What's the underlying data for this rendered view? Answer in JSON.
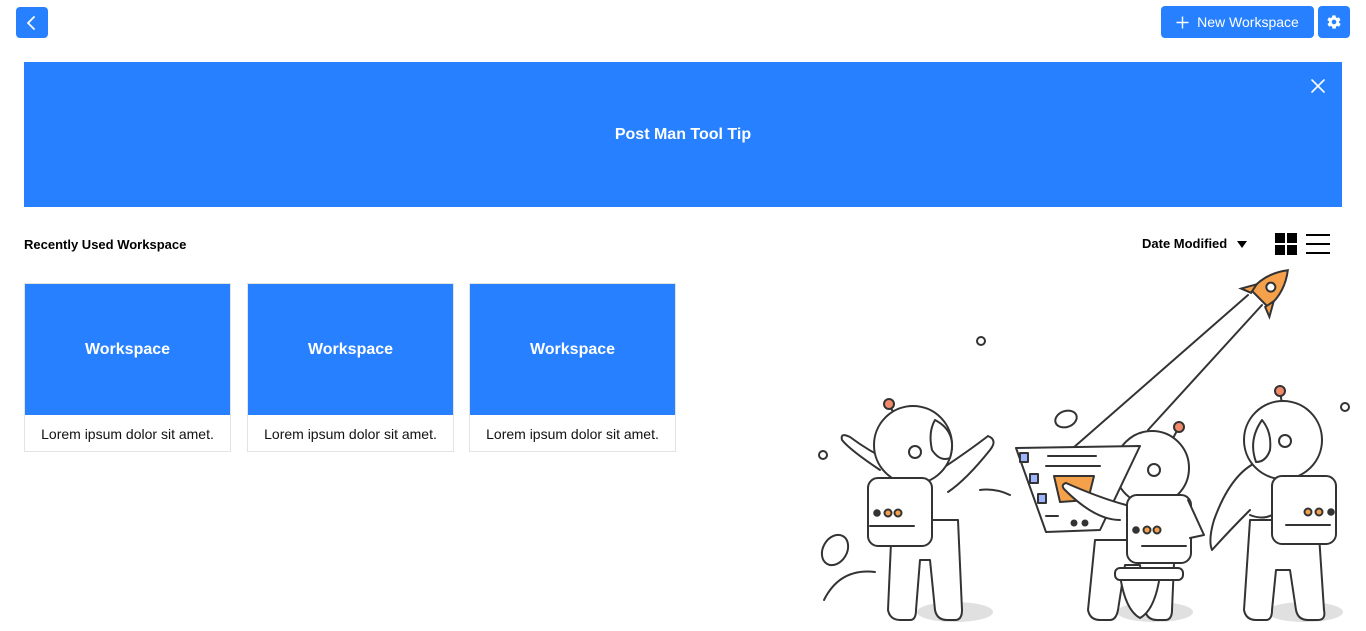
{
  "header": {
    "back_icon": "chevron-left-icon",
    "new_workspace_label": "New Workspace",
    "new_workspace_icon": "plus-icon",
    "settings_icon": "gear-icon"
  },
  "banner": {
    "title": "Post Man Tool Tip",
    "close_icon": "close-icon"
  },
  "section": {
    "title": "Recently Used Workspace"
  },
  "sort": {
    "label": "Date Modified",
    "icon": "caret-down-icon"
  },
  "views": {
    "grid_icon": "grid-view-icon",
    "list_icon": "list-view-icon"
  },
  "workspaces": [
    {
      "title": "Workspace",
      "description": "Lorem ipsum dolor sit amet."
    },
    {
      "title": "Workspace",
      "description": "Lorem ipsum dolor sit amet."
    },
    {
      "title": "Workspace",
      "description": "Lorem ipsum dolor sit amet."
    }
  ],
  "colors": {
    "primary": "#2680ff",
    "accent": "#f5a04a"
  }
}
